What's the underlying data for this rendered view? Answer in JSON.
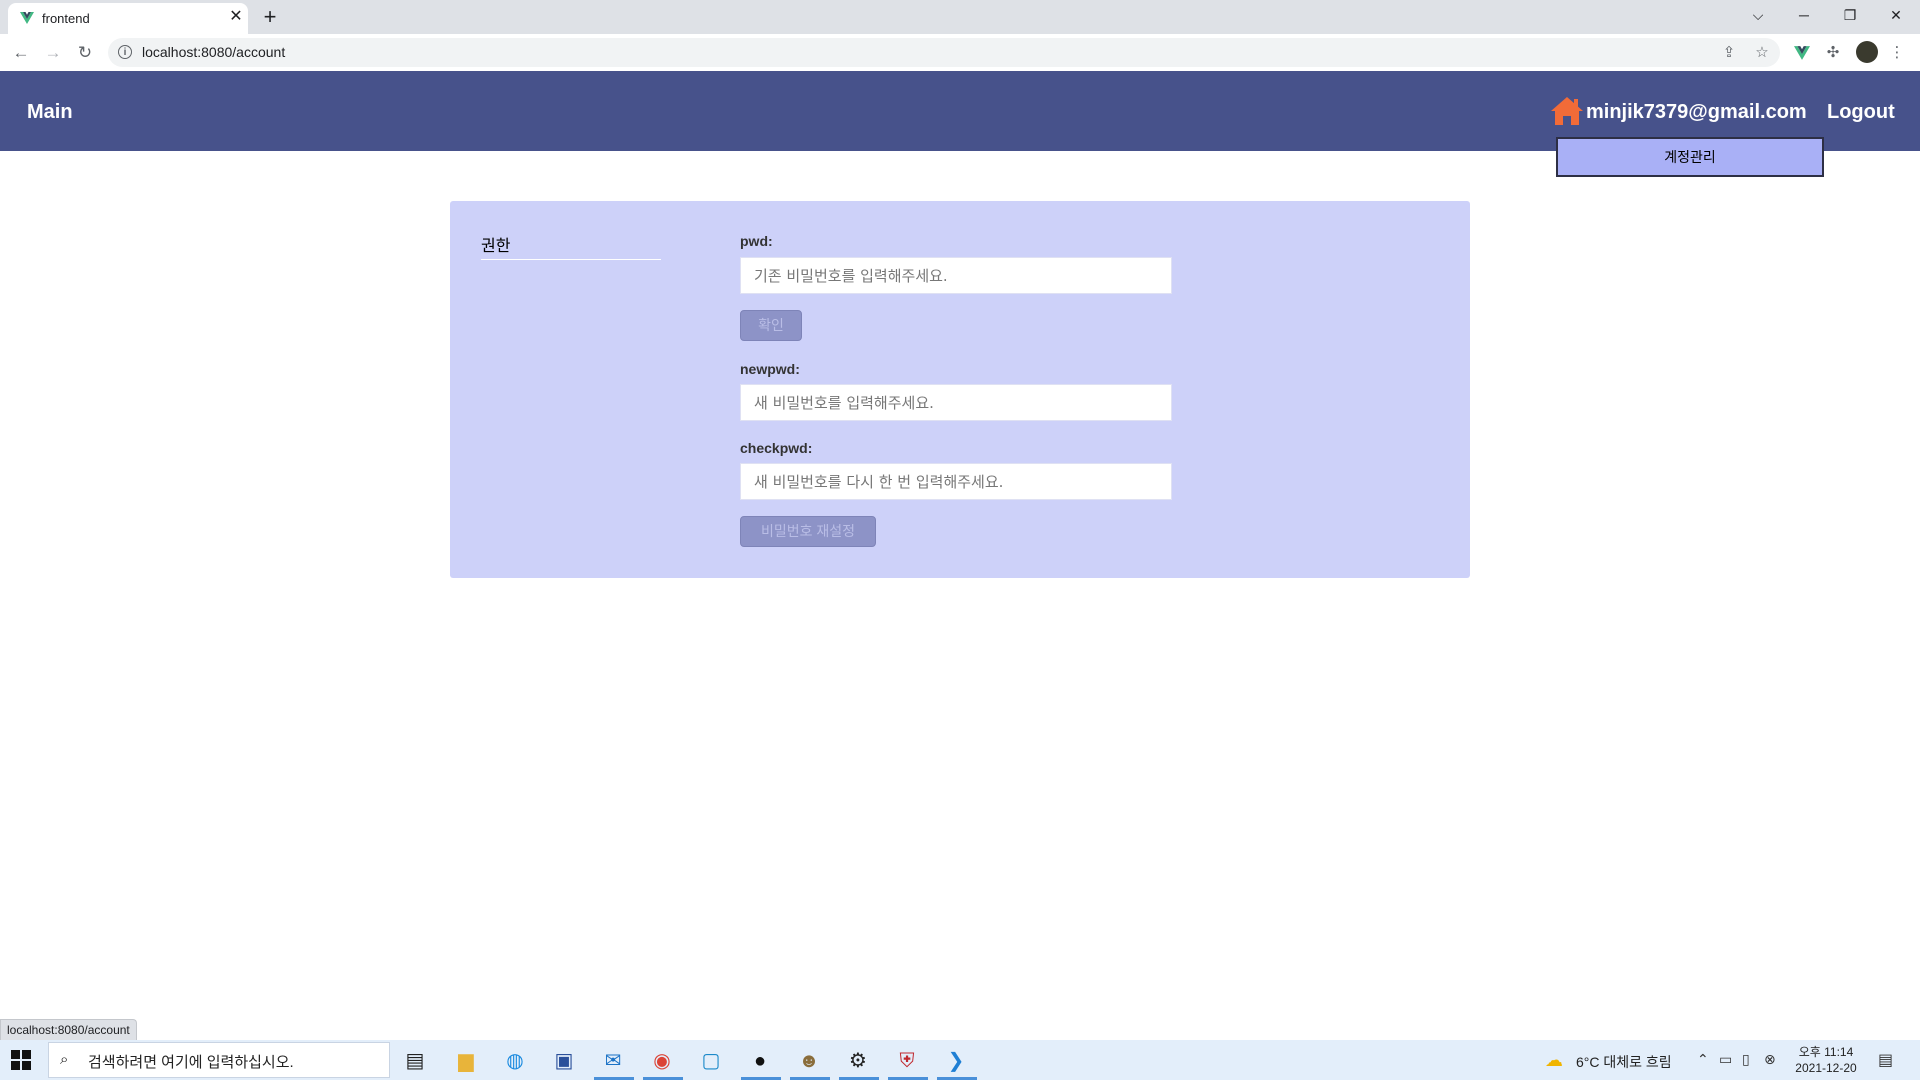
{
  "browser": {
    "tab_title": "frontend",
    "tab_close": "✕",
    "new_tab": "+",
    "url": "localhost:8080/account",
    "status_url": "localhost:8080/account"
  },
  "app": {
    "brand": "Main",
    "user_email": "minjik7379@gmail.com",
    "logout": "Logout",
    "dropdown": {
      "item": "계정관리"
    },
    "sidebar": {
      "item": "권한"
    },
    "form": {
      "pwd_label": "pwd:",
      "pwd_placeholder": "기존 비밀번호를 입력해주세요.",
      "confirm_button": "확인",
      "newpwd_label": "newpwd:",
      "newpwd_placeholder": "새 비밀번호를 입력해주세요.",
      "checkpwd_label": "checkpwd:",
      "checkpwd_placeholder": "새 비밀번호를 다시 한 번 입력해주세요.",
      "reset_button": "비밀번호 재설정"
    }
  },
  "taskbar": {
    "search_placeholder": "검색하려면 여기에 입력하십시오.",
    "weather": "6°C  대체로 흐림",
    "time": "오후 11:14",
    "date": "2021-12-20"
  },
  "colors": {
    "navbar": "#47528b",
    "card": "#cdd1f9",
    "dropdown": "#a9b0f6",
    "button": "#8d93c7",
    "home_icon": "#f26b38"
  }
}
